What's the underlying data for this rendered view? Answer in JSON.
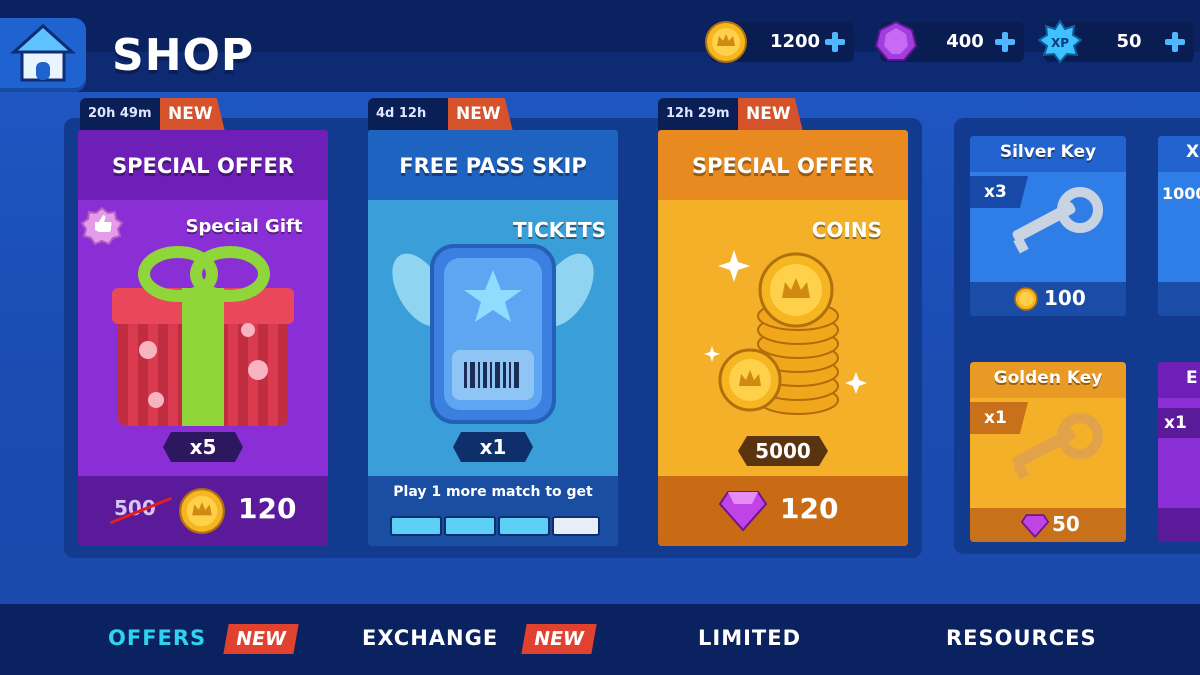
{
  "header": {
    "title": "SHOP"
  },
  "resources": [
    {
      "icon": "coin-icon",
      "value": "1200"
    },
    {
      "icon": "gem-icon",
      "value": "400"
    },
    {
      "icon": "xp-icon",
      "value": "50",
      "badge": "XP"
    }
  ],
  "offers": [
    {
      "timer": "20h 49m",
      "badge": "NEW",
      "title": "SPECIAL OFFER",
      "item_name": "Special Gift",
      "quantity": "x5",
      "old_price": "500",
      "price": "120",
      "currency_icon": "coin-icon",
      "color": "#8a2fd6"
    },
    {
      "timer": "4d 12h",
      "badge": "NEW",
      "title": "FREE PASS SKIP",
      "item_name": "TICKETS",
      "quantity": "x1",
      "progress_text": "Play 1 more match to get",
      "progress_segments": 4,
      "progress_filled": 3,
      "color": "#3a9ed9"
    },
    {
      "timer": "12h 29m",
      "badge": "NEW",
      "title": "SPECIAL OFFER",
      "item_name": "COINS",
      "quantity": "5000",
      "price": "120",
      "currency_icon": "gem-icon",
      "color": "#f0a21e"
    }
  ],
  "keys": [
    {
      "name": "Silver Key",
      "quantity": "x3",
      "price": "100",
      "currency_icon": "coin-icon"
    },
    {
      "name": "Golden Key",
      "quantity": "x1",
      "price": "50",
      "currency_icon": "gem-icon"
    }
  ],
  "partial_cards": [
    {
      "name_fragment": "X",
      "value_fragment": "1000"
    },
    {
      "name_fragment": "E",
      "quantity_fragment": "x1"
    }
  ],
  "tabs": [
    {
      "label": "OFFERS",
      "badge": "NEW",
      "active": true
    },
    {
      "label": "EXCHANGE",
      "badge": "NEW",
      "active": false
    },
    {
      "label": "LIMITED",
      "active": false
    },
    {
      "label": "RESOURCES",
      "active": false
    }
  ],
  "colors": {
    "accent_active_tab": "#2fd3f0",
    "new_badge": "#d5522a",
    "background": "#1b4fb8"
  }
}
